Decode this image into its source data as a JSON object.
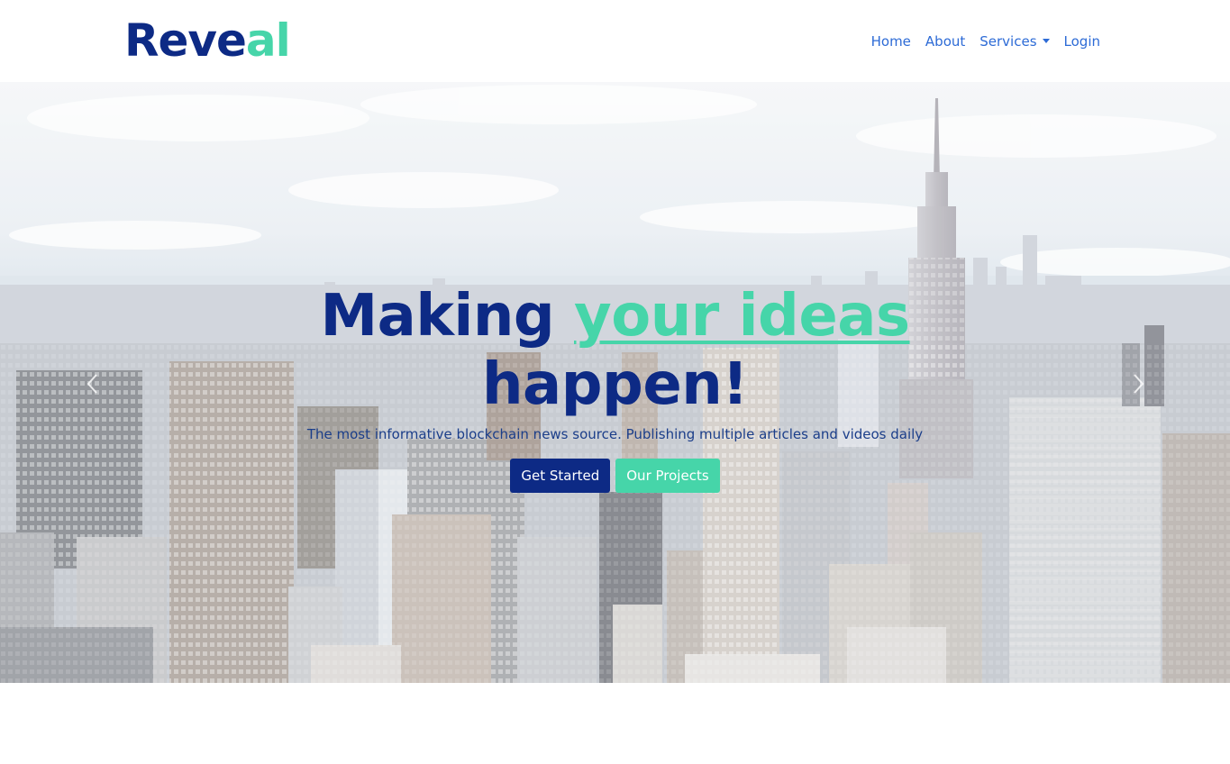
{
  "brand": {
    "part1": "Reve",
    "part2": "al"
  },
  "nav": {
    "items": [
      {
        "label": "Home"
      },
      {
        "label": "About"
      },
      {
        "label": "Services",
        "has_dropdown": true
      },
      {
        "label": "Login"
      }
    ]
  },
  "hero": {
    "headline_part1": "Making ",
    "headline_accent": "your ideas",
    "headline_part2": "happen!",
    "subtitle": "The most informative blockchain news source. Publishing multiple articles and videos daily",
    "primary_button": "Get Started",
    "secondary_button": "Our Projects"
  },
  "icons": {
    "dropdown": "chevron-down-icon",
    "prev": "chevron-left-icon",
    "next": "chevron-right-icon"
  },
  "colors": {
    "brand_dark": "#0d2a85",
    "brand_accent": "#46d5a9",
    "nav_link": "#2d6bd6"
  }
}
